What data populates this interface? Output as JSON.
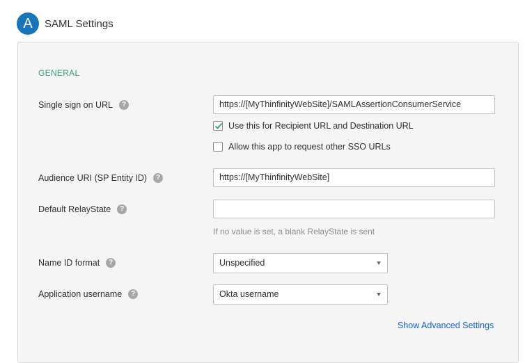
{
  "step": {
    "letter": "A",
    "title": "SAML Settings"
  },
  "section": {
    "title": "GENERAL"
  },
  "fields": {
    "sso_url": {
      "label": "Single sign on URL",
      "value": "https://[MyThinfinityWebSite]/SAMLAssertionConsumerService",
      "recipient_checkbox": {
        "label": "Use this for Recipient URL and Destination URL",
        "checked": true
      },
      "other_sso_checkbox": {
        "label": "Allow this app to request other SSO URLs",
        "checked": false
      }
    },
    "audience_uri": {
      "label": "Audience URI (SP Entity ID)",
      "value": "https://[MyThinfinityWebSite]"
    },
    "relay_state": {
      "label": "Default RelayState",
      "value": "",
      "hint": "If no value is set, a blank RelayState is sent"
    },
    "name_id_format": {
      "label": "Name ID format",
      "selected": "Unspecified"
    },
    "app_username": {
      "label": "Application username",
      "selected": "Okta username"
    }
  },
  "help_icon_glyph": "?",
  "advanced_link": "Show Advanced Settings",
  "colors": {
    "accent": "#1a74b9",
    "section_title": "#31a37c",
    "link": "#1662dd",
    "check": "#31a37c"
  }
}
